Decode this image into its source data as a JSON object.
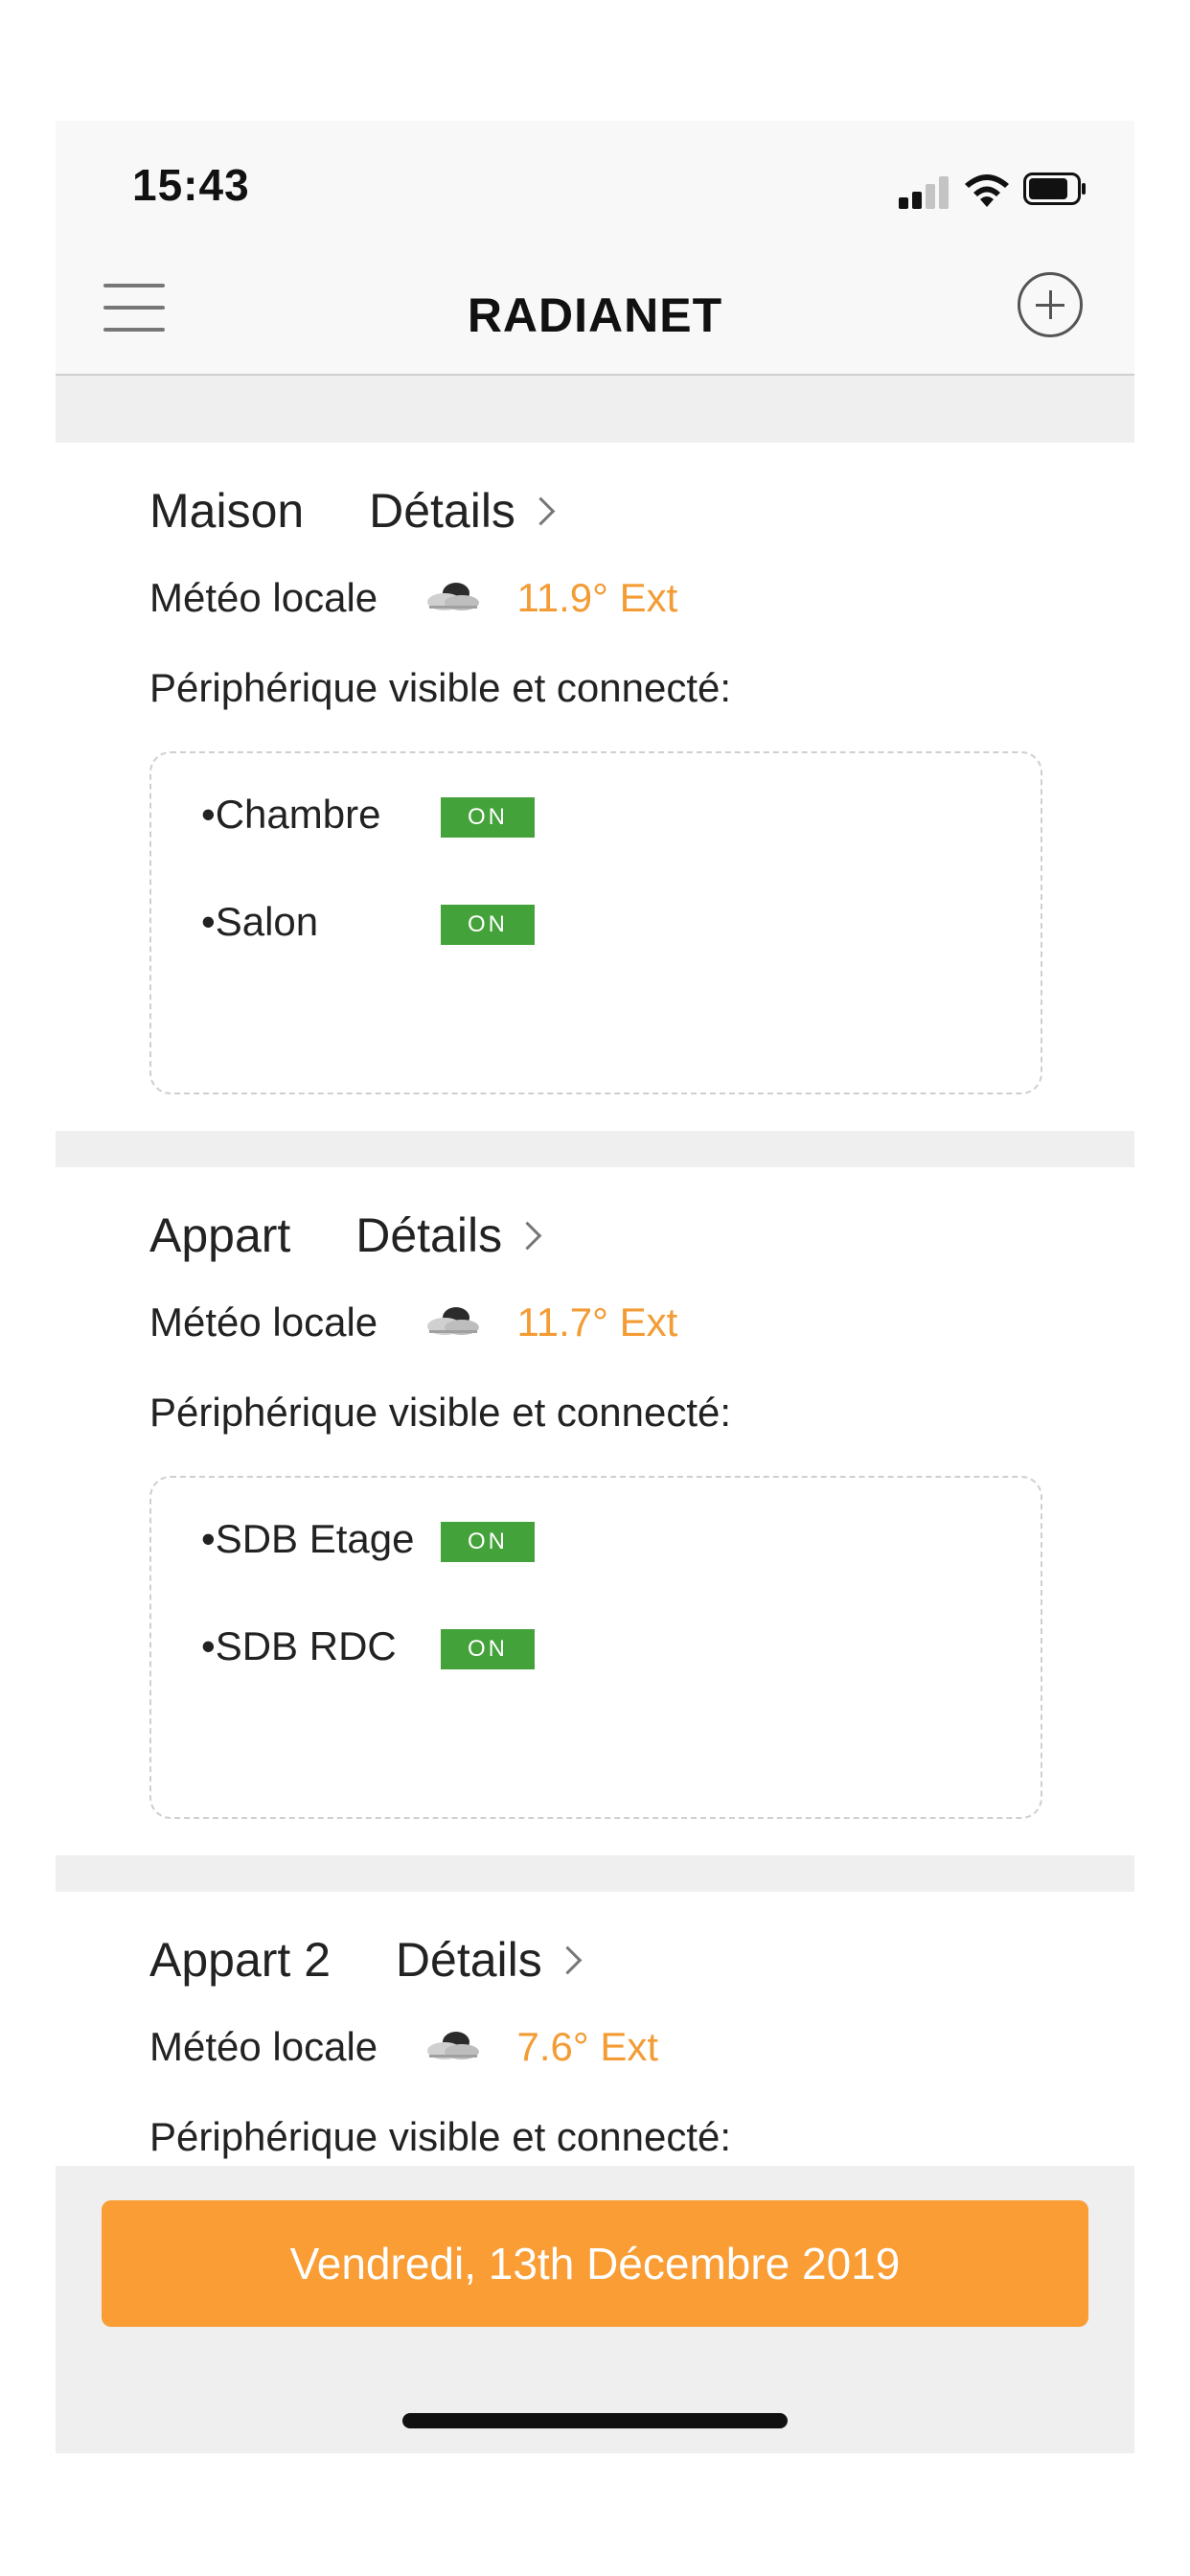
{
  "status_bar": {
    "time": "15:43"
  },
  "nav": {
    "title": "RADIANET",
    "menu_icon": "hamburger-menu-icon",
    "add_icon": "plus-circle-icon"
  },
  "homes": [
    {
      "name": "Maison",
      "details_label": "Détails",
      "weather_label": "Météo locale",
      "weather_icon": "cloud-sun-icon",
      "temperature": "11.9° Ext",
      "devices_label": "Périphérique visible et connecté:",
      "devices": [
        {
          "name": "•Chambre",
          "status": "ON"
        },
        {
          "name": "•Salon",
          "status": "ON"
        }
      ]
    },
    {
      "name": "Appart",
      "details_label": "Détails",
      "weather_label": "Météo locale",
      "weather_icon": "cloud-sun-icon",
      "temperature": "11.7° Ext",
      "devices_label": "Périphérique visible et connecté:",
      "devices": [
        {
          "name": "•SDB Etage",
          "status": "ON"
        },
        {
          "name": "•SDB RDC",
          "status": "ON"
        }
      ]
    },
    {
      "name": "Appart 2",
      "details_label": "Détails",
      "weather_label": "Météo locale",
      "weather_icon": "cloud-sun-icon",
      "temperature": "7.6° Ext",
      "devices_label": "Périphérique visible et connecté:"
    }
  ],
  "footer": {
    "date_label": "Vendredi, 13th Décembre 2019"
  },
  "colors": {
    "accent_orange": "#f99d34",
    "temperature_text": "#f39c35",
    "status_on_green": "#44a23a",
    "background_gray": "#efefef"
  }
}
